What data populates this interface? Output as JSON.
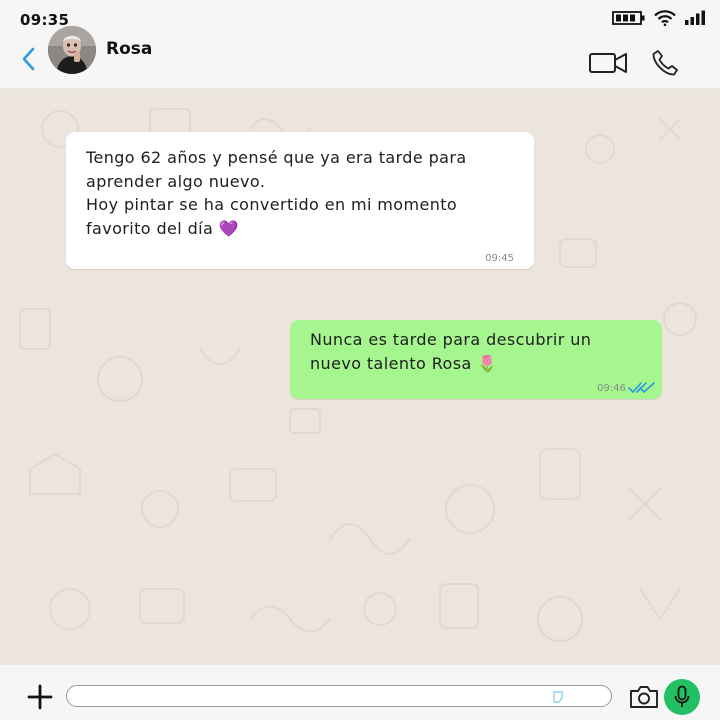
{
  "status_bar": {
    "time": "09:35"
  },
  "header": {
    "contact_name": "Rosa"
  },
  "messages": [
    {
      "direction": "incoming",
      "text": "Tengo 62 años y pensé que ya era tarde para\naprender algo nuevo.\nHoy pintar se ha convertido en mi momento\nfavorito del día 💜",
      "time": "09:45"
    },
    {
      "direction": "outgoing",
      "text": "Nunca es tarde para descubrir un\nnuevo talento Rosa 🌷",
      "time": "09:46",
      "status": "read"
    }
  ],
  "input": {
    "value": "",
    "placeholder": ""
  },
  "colors": {
    "chat_background": "#ece5dd",
    "outgoing_bubble": "#a6f68f",
    "incoming_bubble": "#ffffff",
    "accent_blue": "#2f9be0",
    "mic_green": "#21c063"
  },
  "icons": [
    "signal-icon",
    "wifi-icon",
    "battery-icon",
    "back-chevron-icon",
    "avatar",
    "video-call-icon",
    "phone-icon",
    "read-receipt-icon",
    "plus-icon",
    "sticker-icon",
    "camera-icon",
    "microphone-icon"
  ]
}
